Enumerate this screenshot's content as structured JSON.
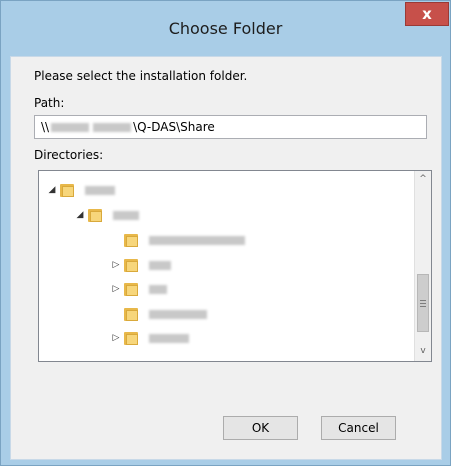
{
  "dialog": {
    "title": "Choose Folder",
    "close_glyph": "x",
    "prompt": "Please select the installation folder.",
    "path_label": "Path:",
    "path_prefix": "\\\\",
    "path_suffix": "\\Q-DAS\\Share",
    "directories_label": "Directories:",
    "ok_label": "OK",
    "cancel_label": "Cancel"
  },
  "tree": {
    "nodes": [
      {
        "expander": "◢",
        "label": "██ ███",
        "expanded": true
      },
      {
        "expander": "◢",
        "label": "████",
        "expanded": true
      },
      {
        "expander": "",
        "label": "████████████"
      },
      {
        "expander": "▷",
        "label": "████"
      },
      {
        "expander": "▷",
        "label": "███"
      },
      {
        "expander": "",
        "label": "████████"
      },
      {
        "expander": "▷",
        "label": "██████"
      }
    ]
  },
  "scrollbar": {
    "up_glyph": "^",
    "down_glyph": "v"
  }
}
